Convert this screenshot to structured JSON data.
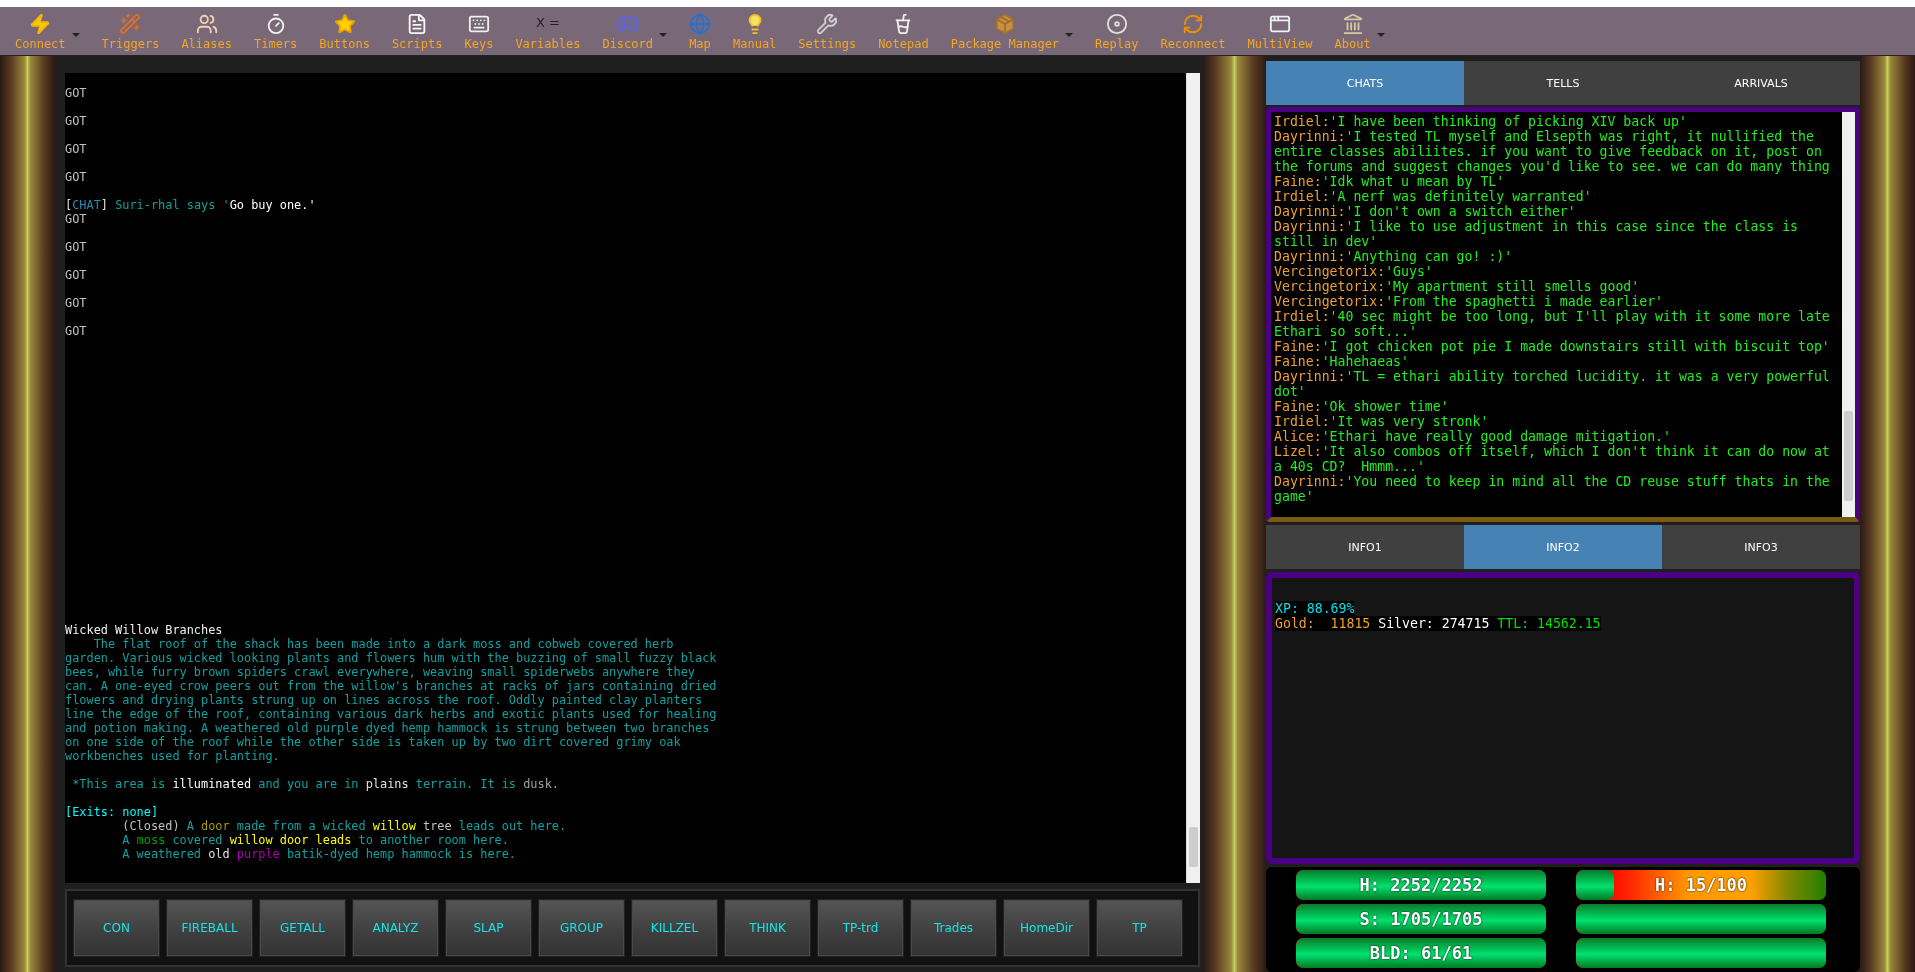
{
  "toolbar": [
    {
      "label": "Connect",
      "has_menu": true
    },
    {
      "label": "Triggers",
      "has_menu": false
    },
    {
      "label": "Aliases",
      "has_menu": false
    },
    {
      "label": "Timers",
      "has_menu": false
    },
    {
      "label": "Buttons",
      "has_menu": false
    },
    {
      "label": "Scripts",
      "has_menu": false
    },
    {
      "label": "Keys",
      "has_menu": false
    },
    {
      "label": "Variables",
      "has_menu": false,
      "glyph": "X ="
    },
    {
      "label": "Discord",
      "has_menu": true
    },
    {
      "label": "Map",
      "has_menu": false
    },
    {
      "label": "Manual",
      "has_menu": false
    },
    {
      "label": "Settings",
      "has_menu": false
    },
    {
      "label": "Notepad",
      "has_menu": false
    },
    {
      "label": "Package Manager",
      "has_menu": true
    },
    {
      "label": "Replay",
      "has_menu": false
    },
    {
      "label": "Reconnect",
      "has_menu": false
    },
    {
      "label": "MultiView",
      "has_menu": false
    },
    {
      "label": "About",
      "has_menu": true
    }
  ],
  "output": {
    "top_lines": [
      {
        "space_after": true,
        "segments": [
          {
            "text": "GOT",
            "color": "#c0c0c0"
          }
        ]
      },
      {
        "space_after": true,
        "segments": [
          {
            "text": "GOT",
            "color": "#c0c0c0"
          }
        ]
      },
      {
        "space_after": true,
        "segments": [
          {
            "text": "GOT",
            "color": "#c0c0c0"
          }
        ]
      },
      {
        "space_after": true,
        "segments": [
          {
            "text": "GOT",
            "color": "#c0c0c0"
          }
        ]
      },
      {
        "space_after": false,
        "segments": [
          {
            "text": "[",
            "color": "#e0e0e0"
          },
          {
            "text": "CHAT",
            "color": "#2a8ab0"
          },
          {
            "text": "]",
            "color": "#e0e0e0"
          },
          {
            "text": " Suri-rhal says '",
            "color": "#13a0a0"
          },
          {
            "text": "Go buy one.'",
            "color": "#ffffff"
          }
        ]
      },
      {
        "space_after": true,
        "segments": [
          {
            "text": "GOT",
            "color": "#c0c0c0"
          }
        ]
      },
      {
        "space_after": true,
        "segments": [
          {
            "text": "GOT",
            "color": "#c0c0c0"
          }
        ]
      },
      {
        "space_after": true,
        "segments": [
          {
            "text": "GOT",
            "color": "#c0c0c0"
          }
        ]
      },
      {
        "space_after": true,
        "segments": [
          {
            "text": "GOT",
            "color": "#c0c0c0"
          }
        ]
      },
      {
        "space_after": false,
        "segments": [
          {
            "text": "GOT",
            "color": "#c0c0c0"
          }
        ]
      }
    ],
    "bottom_lines": [
      {
        "space_after": false,
        "segments": [
          {
            "text": "Wicked Willow Branches",
            "color": "#f0f0f0"
          }
        ]
      },
      {
        "space_after": false,
        "segments": [
          {
            "text": "    The flat roof of the shack has been made into a dark moss and cobweb covered herb",
            "color": "#13a0a0"
          }
        ]
      },
      {
        "space_after": false,
        "segments": [
          {
            "text": "garden. Various wicked looking plants and flowers hum with the buzzing of small fuzzy black",
            "color": "#13a0a0"
          }
        ]
      },
      {
        "space_after": false,
        "segments": [
          {
            "text": "bees, while furry brown spiders crawl everywhere, weaving small spiderwebs anywhere they",
            "color": "#13a0a0"
          }
        ]
      },
      {
        "space_after": false,
        "segments": [
          {
            "text": "can. A one-eyed crow peers out from the willow's branches at racks of jars containing dried",
            "color": "#13a0a0"
          }
        ]
      },
      {
        "space_after": false,
        "segments": [
          {
            "text": "flowers and drying plants strung up on lines across the roof. Oddly painted clay planters",
            "color": "#13a0a0"
          }
        ]
      },
      {
        "space_after": false,
        "segments": [
          {
            "text": "line the edge of the roof, containing various dark herbs and exotic plants used for healing",
            "color": "#13a0a0"
          }
        ]
      },
      {
        "space_after": false,
        "segments": [
          {
            "text": "and potion making. A weathered old purple dyed hemp hammock is strung between two branches",
            "color": "#13a0a0"
          }
        ]
      },
      {
        "space_after": false,
        "segments": [
          {
            "text": "on one side of the roof while the other side is taken up by two dirt covered grimy oak",
            "color": "#13a0a0"
          }
        ]
      },
      {
        "space_after": true,
        "segments": [
          {
            "text": "workbenches used for planting.",
            "color": "#13a0a0"
          }
        ]
      },
      {
        "space_after": true,
        "segments": [
          {
            "text": " *This area is ",
            "color": "#13a0a0"
          },
          {
            "text": "illuminated",
            "color": "#ffffff"
          },
          {
            "text": " and you are in ",
            "color": "#13a0a0"
          },
          {
            "text": "plains",
            "color": "#e0e0e0"
          },
          {
            "text": " terrain. It is ",
            "color": "#13a0a0"
          },
          {
            "text": "dusk.",
            "color": "#a0a0a0"
          }
        ]
      },
      {
        "space_after": false,
        "segments": [
          {
            "text": "[Exits: none]",
            "color": "#00ffff"
          }
        ]
      },
      {
        "space_after": false,
        "indent": true,
        "segments": [
          {
            "text": "(Closed)",
            "color": "#c0c0c0"
          },
          {
            "text": " A ",
            "color": "#13a0a0"
          },
          {
            "text": "door",
            "color": "#a89a00"
          },
          {
            "text": " made from a wicked ",
            "color": "#13a0a0"
          },
          {
            "text": "willow",
            "color": "#ffff00"
          },
          {
            "text": " tree",
            "color": "#c0c0c0"
          },
          {
            "text": " leads out here.",
            "color": "#13a0a0"
          }
        ]
      },
      {
        "space_after": false,
        "indent": true,
        "segments": [
          {
            "text": "A ",
            "color": "#13a0a0"
          },
          {
            "text": "moss",
            "color": "#00a000"
          },
          {
            "text": " covered ",
            "color": "#13a0a0"
          },
          {
            "text": "willow door leads",
            "color": "#ffff00"
          },
          {
            "text": " to another room here.",
            "color": "#13a0a0"
          }
        ]
      },
      {
        "space_after": false,
        "indent": true,
        "segments": [
          {
            "text": "A weathered ",
            "color": "#13a0a0"
          },
          {
            "text": "old",
            "color": "#e0e0e0"
          },
          {
            "text": " purple",
            "color": "#b000b0"
          },
          {
            "text": " batik-dyed hemp hammock is here.",
            "color": "#13a0a0"
          }
        ]
      }
    ]
  },
  "buttons": [
    "CON",
    "FIREBALL",
    "GETALL",
    "ANALYZ",
    "SLAP",
    "GROUP",
    "KILLZEL",
    "THINK",
    "TP-trd",
    "Trades",
    "HomeDir",
    "TP"
  ],
  "chat_tabs": [
    {
      "label": "CHATS",
      "selected": true
    },
    {
      "label": "TELLS",
      "selected": false
    },
    {
      "label": "ARRIVALS",
      "selected": false
    }
  ],
  "chat_messages": [
    {
      "name": "Irdiel:",
      "text": "'I have been thinking of picking XIV back up'"
    },
    {
      "name": "Dayrinni:",
      "text": "'I tested TL myself and Elsepth was right, it nullified the entire classes abiliites. if you want to give feedback on it, post on the forums and suggest changes you'd like to see. we can do many thing"
    },
    {
      "name": "Faine:",
      "text": "'Idk what u mean by TL'"
    },
    {
      "name": "Irdiel:",
      "text": "'A nerf was definitely warranted'"
    },
    {
      "name": "Dayrinni:",
      "text": "'I don't own a switch either'"
    },
    {
      "name": "Dayrinni:",
      "text": "'I like to use adjustment in this case since the class is still in dev'"
    },
    {
      "name": "Dayrinni:",
      "text": "'Anything can go! :)'"
    },
    {
      "name": "Vercingetorix:",
      "text": "'Guys'"
    },
    {
      "name": "Vercingetorix:",
      "text": "'My apartment still smells good'"
    },
    {
      "name": "Vercingetorix:",
      "text": "'From the spaghetti i made earlier'"
    },
    {
      "name": "Irdiel:",
      "text": "'40 sec might be too long, but I'll play with it some more late Ethari so soft...'"
    },
    {
      "name": "Faine:",
      "text": "'I got chicken pot pie I made downstairs still with biscuit top'"
    },
    {
      "name": "Faine:",
      "text": "'Hahehaeas'"
    },
    {
      "name": "Dayrinni:",
      "text": "'TL = ethari ability torched lucidity. it was a very powerful dot'"
    },
    {
      "name": "Faine:",
      "text": "'Ok shower time'"
    },
    {
      "name": "Irdiel:",
      "text": "'It was very stronk'"
    },
    {
      "name": "Alice:",
      "text": "'Ethari have really good damage mitigation.'"
    },
    {
      "name": "Lizel:",
      "text": "'It also combos off itself, which I don't think it can do now at a 40s CD?  Hmmm...'"
    },
    {
      "name": "Dayrinni:",
      "text": "'You need to keep in mind all the CD reuse stuff thats in the game'"
    }
  ],
  "info_tabs": [
    {
      "label": "INFO1",
      "selected": false
    },
    {
      "label": "INFO2",
      "selected": true
    },
    {
      "label": "INFO3",
      "selected": false
    }
  ],
  "info_lines": [
    [
      {
        "text": "XP: 88.69%",
        "color": "#00e0e8"
      }
    ],
    [
      {
        "text": "Gold:  11815",
        "color": "#f0a020"
      },
      {
        "text": " Silver: 274715",
        "color": "#ffffff"
      },
      {
        "text": " TTL: 14562.15",
        "color": "#00e000"
      }
    ]
  ],
  "gauges": [
    {
      "label": "H: 2252/2252",
      "level": 1
    },
    {
      "label": "H: 15/100",
      "level": 0.15
    },
    {
      "label": "S: 1705/1705",
      "level": 1
    },
    {
      "level": 1
    },
    {
      "label": "BLD: 61/61",
      "level": 1
    },
    {
      "level": 1
    }
  ]
}
